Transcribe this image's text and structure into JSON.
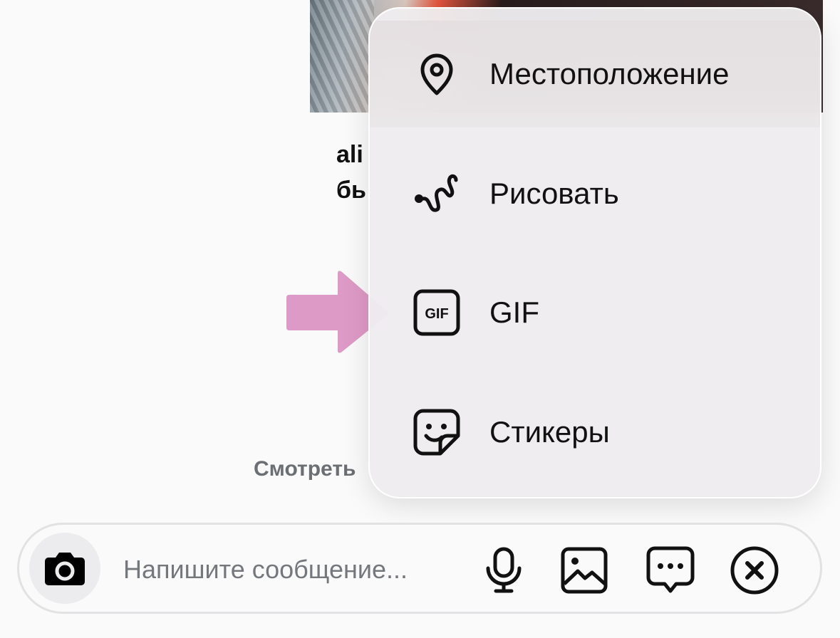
{
  "background_post": {
    "line1": "ali",
    "line2": "бь",
    "view_more": "Смотреть"
  },
  "attachment_menu": {
    "items": [
      {
        "label": "Местоположение",
        "icon": "location-pin-icon"
      },
      {
        "label": "Рисовать",
        "icon": "draw-squiggle-icon"
      },
      {
        "label": "GIF",
        "icon": "gif-icon",
        "icon_text": "GIF"
      },
      {
        "label": "Стикеры",
        "icon": "sticker-icon"
      }
    ]
  },
  "composer": {
    "placeholder": "Напишите сообщение...",
    "icons": [
      "camera-icon",
      "microphone-icon",
      "gallery-icon",
      "quick-reply-icon",
      "close-icon"
    ]
  },
  "colors": {
    "arrow": "#de9ac6",
    "menu_background": "#eeeced",
    "text": "#111111",
    "placeholder": "#74777c"
  }
}
